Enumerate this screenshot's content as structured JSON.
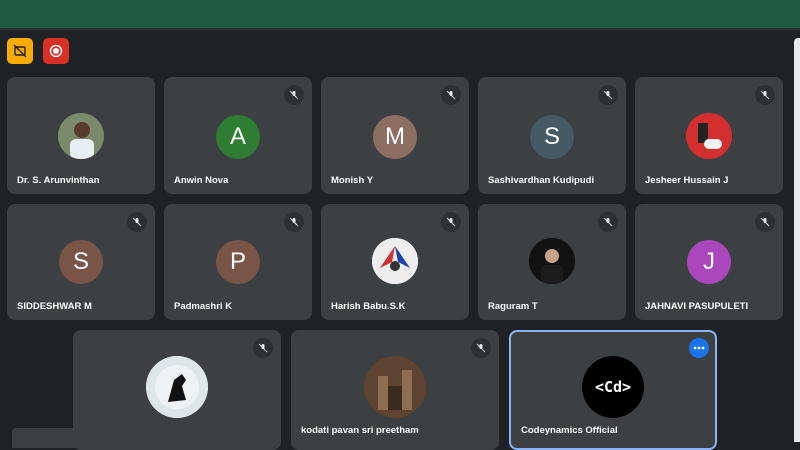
{
  "participants": [
    {
      "name": "Dr. S. Arunvinthan",
      "initial": "",
      "avatar_icon": "person-photo-icon"
    },
    {
      "name": "Anwin Nova",
      "initial": "A",
      "avatar_color": "#2e7d32"
    },
    {
      "name": "Monish Y",
      "initial": "M",
      "avatar_color": "#8d6e63"
    },
    {
      "name": "Sashivardhan Kudipudi",
      "initial": "S",
      "avatar_color": "#455a64"
    },
    {
      "name": "Jesheer Hussain J",
      "initial": "",
      "avatar_icon": "gamepad-photo-icon"
    },
    {
      "name": "SIDDESHWAR M",
      "initial": "S",
      "avatar_color": "#795548"
    },
    {
      "name": "Padmashri K",
      "initial": "P",
      "avatar_color": "#795548"
    },
    {
      "name": "Harish Babu.S.K",
      "initial": "",
      "avatar_icon": "phoenix-photo-icon"
    },
    {
      "name": "Raguram T",
      "initial": "",
      "avatar_icon": "person-photo-icon"
    },
    {
      "name": "JAHNAVI PASUPULETI",
      "initial": "J",
      "avatar_color": "#ab47bc"
    },
    {
      "name": "",
      "initial": "",
      "avatar_icon": "horse-moon-photo-icon"
    },
    {
      "name": "kodati pavan sri preetham",
      "initial": "",
      "avatar_icon": "castle-photo-icon"
    },
    {
      "name": "Codeynamics Official",
      "initial": "",
      "avatar_icon": "codeynamics-logo-icon",
      "logo_text": "<Cd>"
    }
  ],
  "colors": {
    "topbar": "#1e5a43",
    "tile": "#3c4043",
    "background": "#202124",
    "active_border": "#8ab4f8",
    "record": "#d93025",
    "warning": "#f9ab00"
  }
}
